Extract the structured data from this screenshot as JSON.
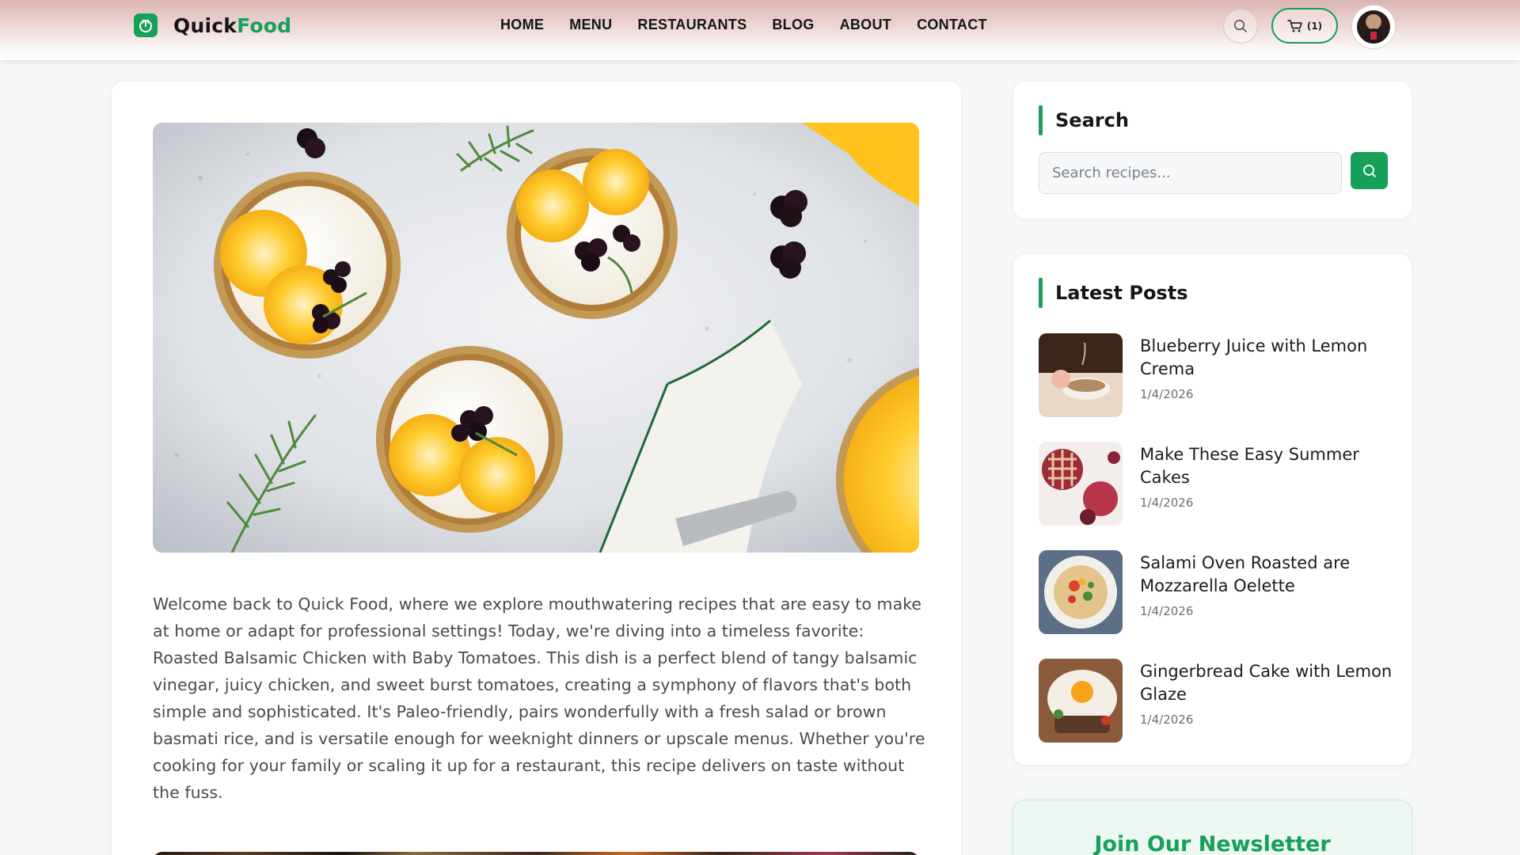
{
  "brand": {
    "name_part1": "Quick",
    "name_part2": "Food",
    "accent": "#16a058"
  },
  "nav": {
    "items": [
      {
        "label": "HOME"
      },
      {
        "label": "MENU"
      },
      {
        "label": "RESTAURANTS"
      },
      {
        "label": "BLOG"
      },
      {
        "label": "ABOUT"
      },
      {
        "label": "CONTACT"
      }
    ]
  },
  "header": {
    "search_icon": "search-icon",
    "cart_icon": "cart-icon",
    "cart_count": "(1)",
    "avatar_icon": "user-avatar"
  },
  "article": {
    "intro": "Welcome back to Quick Food, where we explore mouthwatering recipes that are easy to make at home or adapt for professional settings! Today, we're diving into a timeless favorite: Roasted Balsamic Chicken with Baby Tomatoes. This dish is a perfect blend of tangy balsamic vinegar, juicy chicken, and sweet burst tomatoes, creating a symphony of flavors that's both simple and sophisticated. It's Paleo-friendly, pairs wonderfully with a fresh salad or brown basmati rice, and is versatile enough for weeknight dinners or upscale menus. Whether you're cooking for your family or scaling it up for a restaurant, this recipe delivers on taste without the fuss."
  },
  "sidebar": {
    "search": {
      "title": "Search",
      "placeholder": "Search recipes..."
    },
    "latest": {
      "title": "Latest Posts",
      "posts": [
        {
          "title": "Blueberry Juice with Lemon Crema",
          "date": "1/4/2026"
        },
        {
          "title": "Make These Easy Summer Cakes",
          "date": "1/4/2026"
        },
        {
          "title": "Salami Oven Roasted are Mozzarella Oelette",
          "date": "1/4/2026"
        },
        {
          "title": "Gingerbread Cake with Lemon Glaze",
          "date": "1/4/2026"
        }
      ]
    },
    "newsletter": {
      "title": "Join Our Newsletter"
    }
  }
}
